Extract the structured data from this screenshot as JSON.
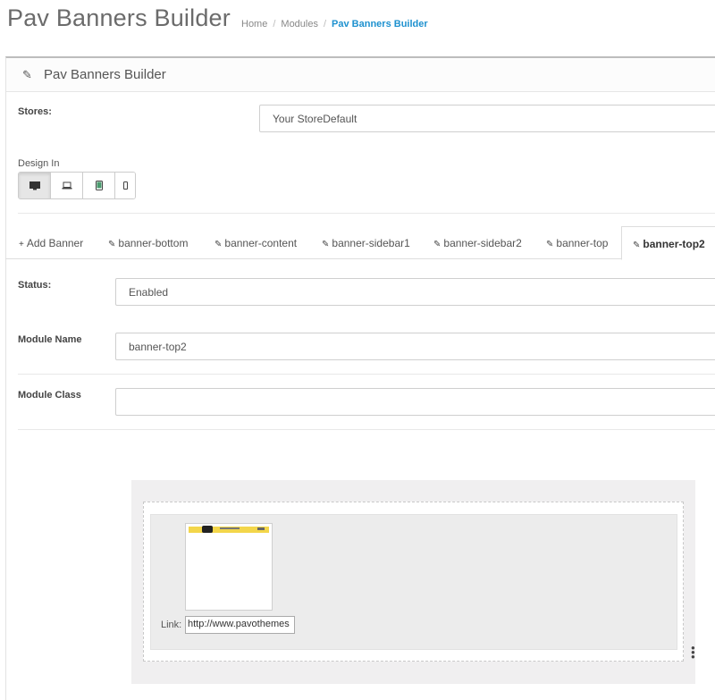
{
  "header": {
    "title": "Pav Banners Builder",
    "breadcrumb": {
      "home": "Home",
      "sep1": "/",
      "modules": "Modules",
      "sep2": "/",
      "current": "Pav Banners Builder"
    }
  },
  "panel": {
    "heading": "Pav Banners Builder",
    "heading_icon": "pencil-icon"
  },
  "stores": {
    "label": "Stores:",
    "value": "Your StoreDefault"
  },
  "design": {
    "label": "Design In",
    "devices": [
      {
        "icon": "desktop-icon",
        "active": true
      },
      {
        "icon": "laptop-icon",
        "active": false
      },
      {
        "icon": "tablet-icon",
        "active": false
      },
      {
        "icon": "phone-icon",
        "active": false
      }
    ]
  },
  "tabs": [
    {
      "label": "Add Banner",
      "icon": "plus-icon"
    },
    {
      "label": "banner-bottom",
      "icon": "pencil-icon"
    },
    {
      "label": "banner-content",
      "icon": "pencil-icon"
    },
    {
      "label": "banner-sidebar1",
      "icon": "pencil-icon"
    },
    {
      "label": "banner-sidebar2",
      "icon": "pencil-icon"
    },
    {
      "label": "banner-top",
      "icon": "pencil-icon"
    },
    {
      "label": "banner-top2",
      "icon": "pencil-icon",
      "active": true
    }
  ],
  "form": {
    "status_label": "Status:",
    "status_value": "Enabled",
    "module_name_label": "Module Name",
    "module_name_value": "banner-top2",
    "module_class_label": "Module Class",
    "module_class_value": ""
  },
  "builder": {
    "link_label": "Link:",
    "link_value": "http://www.pavothemes"
  },
  "colors": {
    "accent": "#1e91cf",
    "builder_bg": "#f0eff0",
    "thumb_strip": "#f3d64a"
  }
}
